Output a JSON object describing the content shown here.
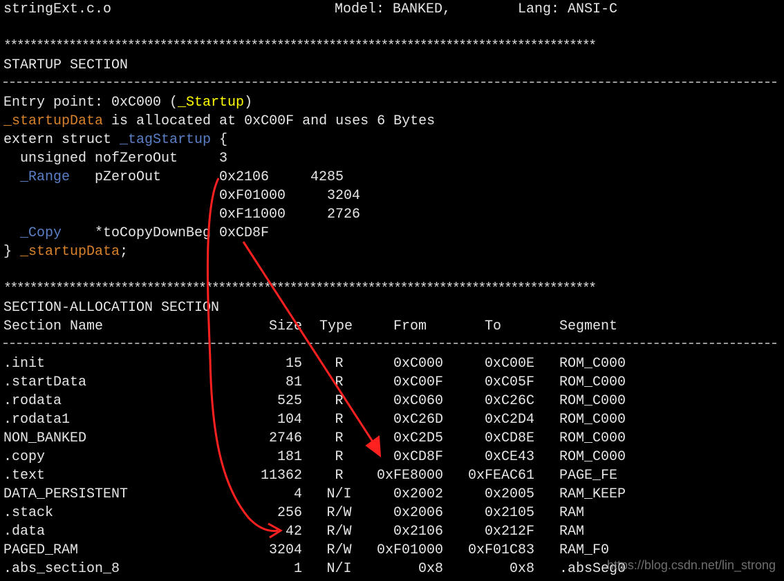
{
  "header": {
    "file": "stringExt.c.o",
    "model": "Model: BANKED,",
    "lang": "Lang: ANSI-C"
  },
  "stars": "*******************************************************************************************",
  "startup": {
    "title": "STARTUP SECTION",
    "entry_prefix": "Entry point: 0xC000 (",
    "entry_symbol": "_Startup",
    "entry_suffix": ")",
    "alloc_symbol": "_startupData",
    "alloc_text": " is allocated at 0xC00F and uses 6 Bytes",
    "extern_prefix": "extern struct ",
    "extern_tag": "_tagStartup",
    "extern_brace": " {",
    "field1_type": "unsigned",
    "field1_name": "nofZeroOut",
    "field1_value": "3",
    "field2_type": "_Range",
    "field2_name": "pZeroOut",
    "range_rows": [
      {
        "addr": "0x2106",
        "size": "4285"
      },
      {
        "addr": "0xF01000",
        "size": "3204"
      },
      {
        "addr": "0xF11000",
        "size": "2726"
      }
    ],
    "field3_type": "_Copy",
    "field3_name": "*toCopyDownBeg",
    "field3_value": "0xCD8F",
    "close_brace": "}",
    "close_symbol": "_startupData",
    "close_semicolon": ";"
  },
  "allocation": {
    "title": "SECTION-ALLOCATION SECTION",
    "columns": {
      "name": "Section Name",
      "size": "Size",
      "type": "Type",
      "from": "From",
      "to": "To",
      "segment": "Segment"
    },
    "rows": [
      {
        "name": ".init",
        "size": "15",
        "type": "R",
        "from": "0xC000",
        "to": "0xC00E",
        "segment": "ROM_C000"
      },
      {
        "name": ".startData",
        "size": "81",
        "type": "R",
        "from": "0xC00F",
        "to": "0xC05F",
        "segment": "ROM_C000"
      },
      {
        "name": ".rodata",
        "size": "525",
        "type": "R",
        "from": "0xC060",
        "to": "0xC26C",
        "segment": "ROM_C000"
      },
      {
        "name": ".rodata1",
        "size": "104",
        "type": "R",
        "from": "0xC26D",
        "to": "0xC2D4",
        "segment": "ROM_C000"
      },
      {
        "name": "NON_BANKED",
        "size": "2746",
        "type": "R",
        "from": "0xC2D5",
        "to": "0xCD8E",
        "segment": "ROM_C000"
      },
      {
        "name": ".copy",
        "size": "181",
        "type": "R",
        "from": "0xCD8F",
        "to": "0xCE43",
        "segment": "ROM_C000"
      },
      {
        "name": ".text",
        "size": "11362",
        "type": "R",
        "from": "0xFE8000",
        "to": "0xFEAC61",
        "segment": "PAGE_FE"
      },
      {
        "name": "DATA_PERSISTENT",
        "size": "4",
        "type": "N/I",
        "from": "0x2002",
        "to": "0x2005",
        "segment": "RAM_KEEP"
      },
      {
        "name": ".stack",
        "size": "256",
        "type": "R/W",
        "from": "0x2006",
        "to": "0x2105",
        "segment": "RAM"
      },
      {
        "name": ".data",
        "size": "42",
        "type": "R/W",
        "from": "0x2106",
        "to": "0x212F",
        "segment": "RAM"
      },
      {
        "name": "PAGED_RAM",
        "size": "3204",
        "type": "R/W",
        "from": "0xF01000",
        "to": "0xF01C83",
        "segment": "RAM_F0"
      },
      {
        "name": ".abs_section_8",
        "size": "1",
        "type": "N/I",
        "from": "0x8",
        "to": "0x8",
        "segment": ".absSeg0"
      }
    ]
  },
  "watermark": "https://blog.csdn.net/lin_strong",
  "colors": {
    "background": "#000000",
    "text": "#e6e6e6",
    "symbol_yellow": "#ffff00",
    "symbol_orange": "#d9822b",
    "type_blue": "#5b7fc7",
    "annotation_red": "#ff2020"
  }
}
